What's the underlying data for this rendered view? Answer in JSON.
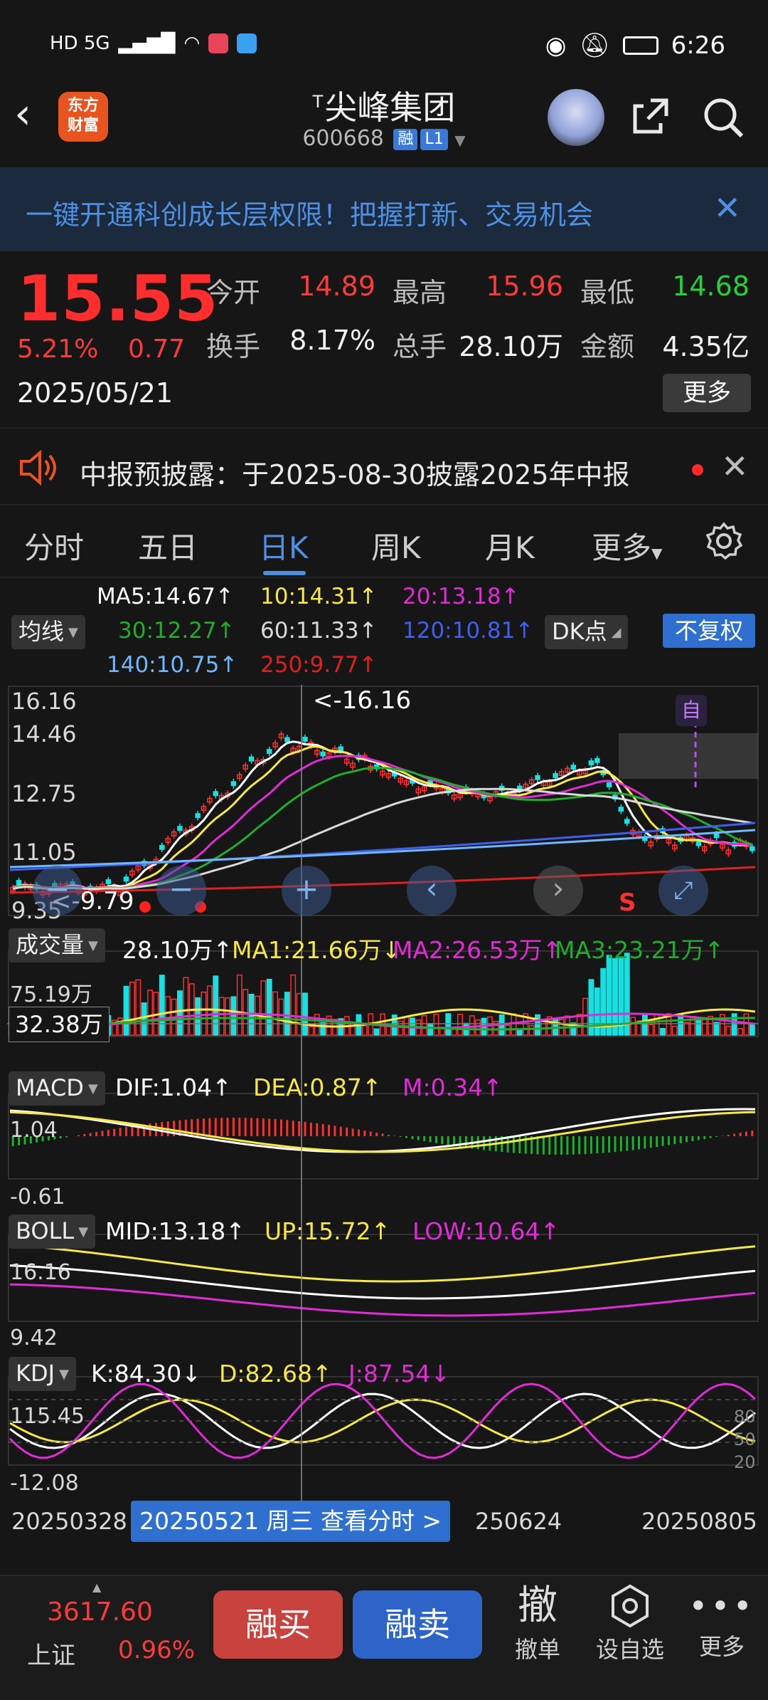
{
  "statusbar": {
    "left_icons": "HD 5G",
    "time": "6:26"
  },
  "header": {
    "title": "尖峰集团",
    "title_mark": "T",
    "code": "600668",
    "tag1": "融",
    "tag2": "L1",
    "logo_line1": "东方",
    "logo_line2": "财富"
  },
  "banner": {
    "text": "一键开通科创成长层权限！把握打新、交易机会",
    "close": "✕"
  },
  "quote": {
    "price": "15.55",
    "pct": "5.21%",
    "change": "0.77",
    "date": "2025/05/21",
    "open_label": "今开",
    "open": "14.89",
    "high_label": "最高",
    "high": "15.96",
    "low_label": "最低",
    "low": "14.68",
    "turnover_label": "换手",
    "turnover": "8.17%",
    "volume_label": "总手",
    "volume": "28.10万",
    "amount_label": "金额",
    "amount": "4.35亿",
    "more": "更多"
  },
  "notice": {
    "text": "中报预披露：于2025-08-30披露2025年中报",
    "close": "✕"
  },
  "tabs": [
    {
      "label": "分时"
    },
    {
      "label": "五日"
    },
    {
      "label": "日K"
    },
    {
      "label": "周K"
    },
    {
      "label": "月K"
    },
    {
      "label": "更多"
    }
  ],
  "ma": {
    "button": "均线",
    "ma5": "MA5:14.67↑",
    "ma10": "10:14.31↑",
    "ma20": "20:13.18↑",
    "ma30": "30:12.27↑",
    "ma60": "60:11.33↑",
    "ma120": "120:10.81↑",
    "ma140": "140:10.75↑",
    "ma250": "250:9.77↑",
    "dk": "DK点",
    "fuquan": "不复权"
  },
  "colors": {
    "ma5": "#ffffff",
    "ma10": "#f7e846",
    "ma20": "#e22bd8",
    "ma30": "#1fae2d",
    "ma60": "#d8d8d8",
    "ma120": "#3f5ff0",
    "ma140": "#6fb6ff",
    "ma250": "#e02020",
    "up": "#ff3030",
    "down": "#18e0e0"
  },
  "kchart": {
    "y_top": "16.16",
    "y_2": "14.46",
    "y_3": "12.75",
    "y_4": "11.05",
    "y_bottom": "9.35",
    "max_label": "<-16.16",
    "min_label": "<-9.79",
    "zi": "自",
    "s_mark": "S"
  },
  "volume": {
    "button": "成交量",
    "val": "28.10万↑",
    "ma1": "MA1:21.66万↓",
    "ma2": "MA2:26.53万↑",
    "ma3": "MA3:23.21万↑",
    "y_top": "75.19万",
    "cursor": "32.38万"
  },
  "macd": {
    "button": "MACD",
    "dif": "DIF:1.04↑",
    "dea": "DEA:0.87↑",
    "m": "M:0.34↑",
    "y_top": "1.04",
    "y_bottom": "-0.61"
  },
  "boll": {
    "button": "BOLL",
    "mid": "MID:13.18↑",
    "up": "UP:15.72↑",
    "low": "LOW:10.64↑",
    "y_top": "16.16",
    "y_bottom": "9.42"
  },
  "kdj": {
    "button": "KDJ",
    "k": "K:84.30↓",
    "d": "D:82.68↑",
    "j": "J:87.54↓",
    "y_top": "115.45",
    "y_bottom": "-12.08",
    "r80": "80",
    "r50": "50",
    "r20": "20"
  },
  "xaxis": {
    "start": "20250328",
    "cursor": "20250521 周三 查看分时 >",
    "mid": "250624",
    "end": "20250805"
  },
  "bottom": {
    "index_value": "3617.60",
    "index_name": "上证",
    "index_pct": "0.96%",
    "buy": "融买",
    "sell": "融卖",
    "cancel_big": "撤",
    "cancel": "撤单",
    "watch": "设自选",
    "more": "更多"
  }
}
